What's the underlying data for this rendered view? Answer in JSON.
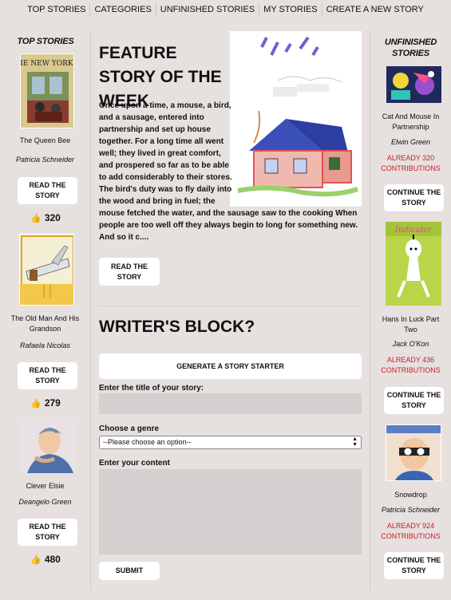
{
  "nav": {
    "items": [
      "TOP STORIES",
      "CATEGORIES",
      "UNFINISHED STORIES",
      "MY STORIES",
      "CREATE A NEW STORY"
    ]
  },
  "top_stories": {
    "heading": "TOP STORIES",
    "items": [
      {
        "title": "The Queen Bee",
        "author": "Patricia Schneider",
        "button": "READ THE STORY",
        "likes": "320",
        "cover_masthead": "THE NEW YORKER"
      },
      {
        "title": "The Old Man And His Grandson",
        "author": "Rafaela Nicolas",
        "button": "READ THE STORY",
        "likes": "279"
      },
      {
        "title": "Clever Elsie",
        "author": "Deangelo Green",
        "button": "READ THE STORY",
        "likes": "480"
      }
    ]
  },
  "feature": {
    "title": "FEATURE STORY OF THE WEEK",
    "text_lines": [
      "Once upon a time, a mouse, a bird,",
      "and a sausage, entered into",
      "partnership and set up house",
      "together. For a long time all went",
      "well; they lived in great comfort,",
      "and prospered so far as to be able",
      "to add considerably to their stores.",
      "The bird's duty was to fly daily into",
      "the wood and bring in fuel; the",
      "mouse fetched the water, and the sausage saw to the cooking When",
      "people are too well off they always begin to long for something new.",
      "And so it c...."
    ],
    "button": "READ THE STORY"
  },
  "writers_block": {
    "title": "WRITER'S BLOCK?",
    "generate_button": "GENERATE A STORY STARTER",
    "title_label": "Enter the title of your story:",
    "title_value": "",
    "genre_label": "Choose a genre",
    "genre_selected": "--Please choose an option--",
    "content_label": "Enter your content",
    "content_value": "",
    "submit": "SUBMIT"
  },
  "unfinished": {
    "heading": "UNFINISHED STORIES",
    "items": [
      {
        "title": "Cat And Mouse In Partnership",
        "author": "Elwin Green",
        "contrib": "ALREADY 320 CONTRIBUTIONS",
        "button": "CONTINUE THE STORY"
      },
      {
        "title": "Hans In Luck Part Two",
        "author": "Jack O'Kon",
        "contrib": "ALREADY 436 CONTRIBUTIONS",
        "button": "CONTINUE THE STORY",
        "cover_masthead": "Indicator"
      },
      {
        "title": "Snowdrop",
        "author": "Patricia Schneider",
        "contrib": "ALREADY 924 CONTRIBUTIONS",
        "button": "CONTINUE THE STORY"
      }
    ]
  },
  "colors": {
    "background": "#e6e0df",
    "accent_red": "#c8202a"
  }
}
